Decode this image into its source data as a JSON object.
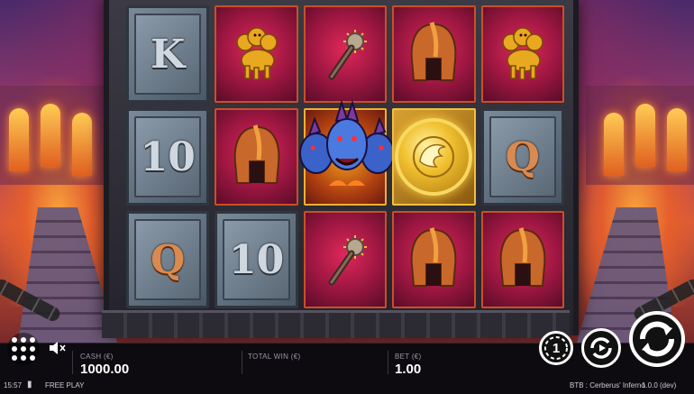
{
  "game": {
    "title": "BTB : Cerberus' Inferno",
    "version": "1.0.0 (dev)",
    "mode": "FREE PLAY",
    "clock": "15:57"
  },
  "reels": {
    "rows": [
      [
        {
          "symbol": "K",
          "kind": "letter"
        },
        {
          "symbol": "cerberus-gold-icon",
          "kind": "icon"
        },
        {
          "symbol": "flail-icon",
          "kind": "icon"
        },
        {
          "symbol": "helmet-icon",
          "kind": "icon"
        },
        {
          "symbol": "cerberus-gold-icon",
          "kind": "icon"
        }
      ],
      [
        {
          "symbol": "10",
          "kind": "letter"
        },
        {
          "symbol": "helmet-icon",
          "kind": "icon"
        },
        {
          "symbol": "cerberus-wild-icon",
          "kind": "icon"
        },
        {
          "symbol": "scatter-coin-icon",
          "kind": "icon"
        },
        {
          "symbol": "Q",
          "kind": "letter"
        }
      ],
      [
        {
          "symbol": "Q",
          "kind": "letter"
        },
        {
          "symbol": "10",
          "kind": "letter"
        },
        {
          "symbol": "flail-icon",
          "kind": "icon"
        },
        {
          "symbol": "helmet-icon",
          "kind": "icon"
        },
        {
          "symbol": "helmet-icon",
          "kind": "icon"
        }
      ]
    ],
    "letters": {
      "k": "K",
      "ten": "10",
      "q": "Q"
    }
  },
  "hud": {
    "cash_label": "CASH (€)",
    "cash_value": "1000.00",
    "total_win_label": "TOTAL WIN (€)",
    "total_win_value": "",
    "bet_label": "BET (€)",
    "bet_value": "1.00"
  },
  "controls": {
    "bet_button_glyph": "1",
    "icons": [
      "menu-icon",
      "mute-icon",
      "bet-icon",
      "autoplay-icon",
      "spin-icon"
    ]
  },
  "colors": {
    "accent": "#ffffff",
    "bar": "#0e0b10",
    "red_tile": "#9a1640",
    "stone_tile": "#5a6876",
    "gold": "#f0c030"
  }
}
